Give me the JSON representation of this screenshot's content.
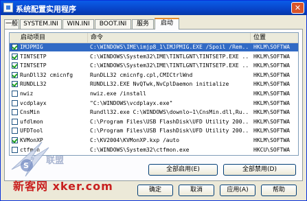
{
  "window": {
    "title": "系统配置实用程序",
    "close_glyph": "✕"
  },
  "tabs": [
    "一般",
    "SYSTEM.INI",
    "WIN.INI",
    "BOOT.INI",
    "服务",
    "启动"
  ],
  "columns": {
    "item": "启动项目",
    "command": "命令",
    "location": "位置"
  },
  "rows": [
    {
      "item": "IMJPMIG",
      "command": "C:\\WINDOWS\\IME\\imjp8_1\\IMJPMIG.EXE /Spoil /Rem...",
      "location": "HKLM\\SOFTWA",
      "checked": true,
      "selected": true
    },
    {
      "item": "TINTSETP",
      "command": "C:\\WINDOWS\\System32\\IME\\TINTLGNT\\TINTSETP.EXE ...",
      "location": "HKLM\\SOFTWA",
      "checked": true,
      "selected": false
    },
    {
      "item": "TINTSETP",
      "command": "C:\\WINDOWS\\System32\\IME\\TINTLGNT\\TINTSETP.EXE ...",
      "location": "HKLM\\SOFTWA",
      "checked": true,
      "selected": false
    },
    {
      "item": "RunDll32 cmicnfg",
      "command": "RunDLL32 cmicnfg.cpl,CMICtrlWnd",
      "location": "HKLM\\SOFTWA",
      "checked": true,
      "selected": false
    },
    {
      "item": "RUNDLL32",
      "command": "RUNDLL32.EXE NvQTwk,NvCplDaemon initialize",
      "location": "HKLM\\SOFTWA",
      "checked": true,
      "selected": false
    },
    {
      "item": "nwiz",
      "command": "nwiz.exe /install",
      "location": "HKLM\\SOFTWA",
      "checked": false,
      "selected": false
    },
    {
      "item": "vcdplayx",
      "command": "\"C:\\WINDOWS\\vcdplayx.exe\"",
      "location": "HKLM\\SOFTWA",
      "checked": false,
      "selected": false
    },
    {
      "item": "CnsMin",
      "command": "Rundll32.exe C:\\WINDOWS\\downlo~1\\CnsMin.dll,Ru...",
      "location": "HKLM\\SOFTWA",
      "checked": false,
      "selected": false
    },
    {
      "item": "ufdlmon",
      "command": "C:\\Program Files\\USB FlashDisk\\UFD Utility 200...",
      "location": "HKLM\\SOFTWA",
      "checked": false,
      "selected": false
    },
    {
      "item": "UFDTool",
      "command": "C:\\Program Files\\USB FlashDisk\\UFD Utility 200...",
      "location": "HKLM\\SOFTWA",
      "checked": false,
      "selected": false
    },
    {
      "item": "KVMonXP",
      "command": "C:\\KV2004\\KVMonXP.kxp /auto",
      "location": "HKLM\\SOFTWA",
      "checked": true,
      "selected": false
    },
    {
      "item": "ctfmon",
      "command": "C:\\WINDOWS\\System32\\ctfmon.exe",
      "location": "HKCU\\SOFTWA",
      "checked": false,
      "selected": false
    }
  ],
  "panel_buttons": {
    "enable_all": "全部启用(E)",
    "disable_all": "全部禁用(D)"
  },
  "dialog_buttons": {
    "ok": "确定",
    "cancel": "取消",
    "apply": "应用(A)",
    "help": "帮助"
  },
  "watermark": {
    "text": "新客网 xker.com",
    "mid": "联盟"
  },
  "colors": {
    "titlebar": "#0844c8",
    "selection": "#316ac5",
    "active_tab_accent": "#e68b2c",
    "face": "#ece9d8",
    "watermark": "#c82020"
  }
}
